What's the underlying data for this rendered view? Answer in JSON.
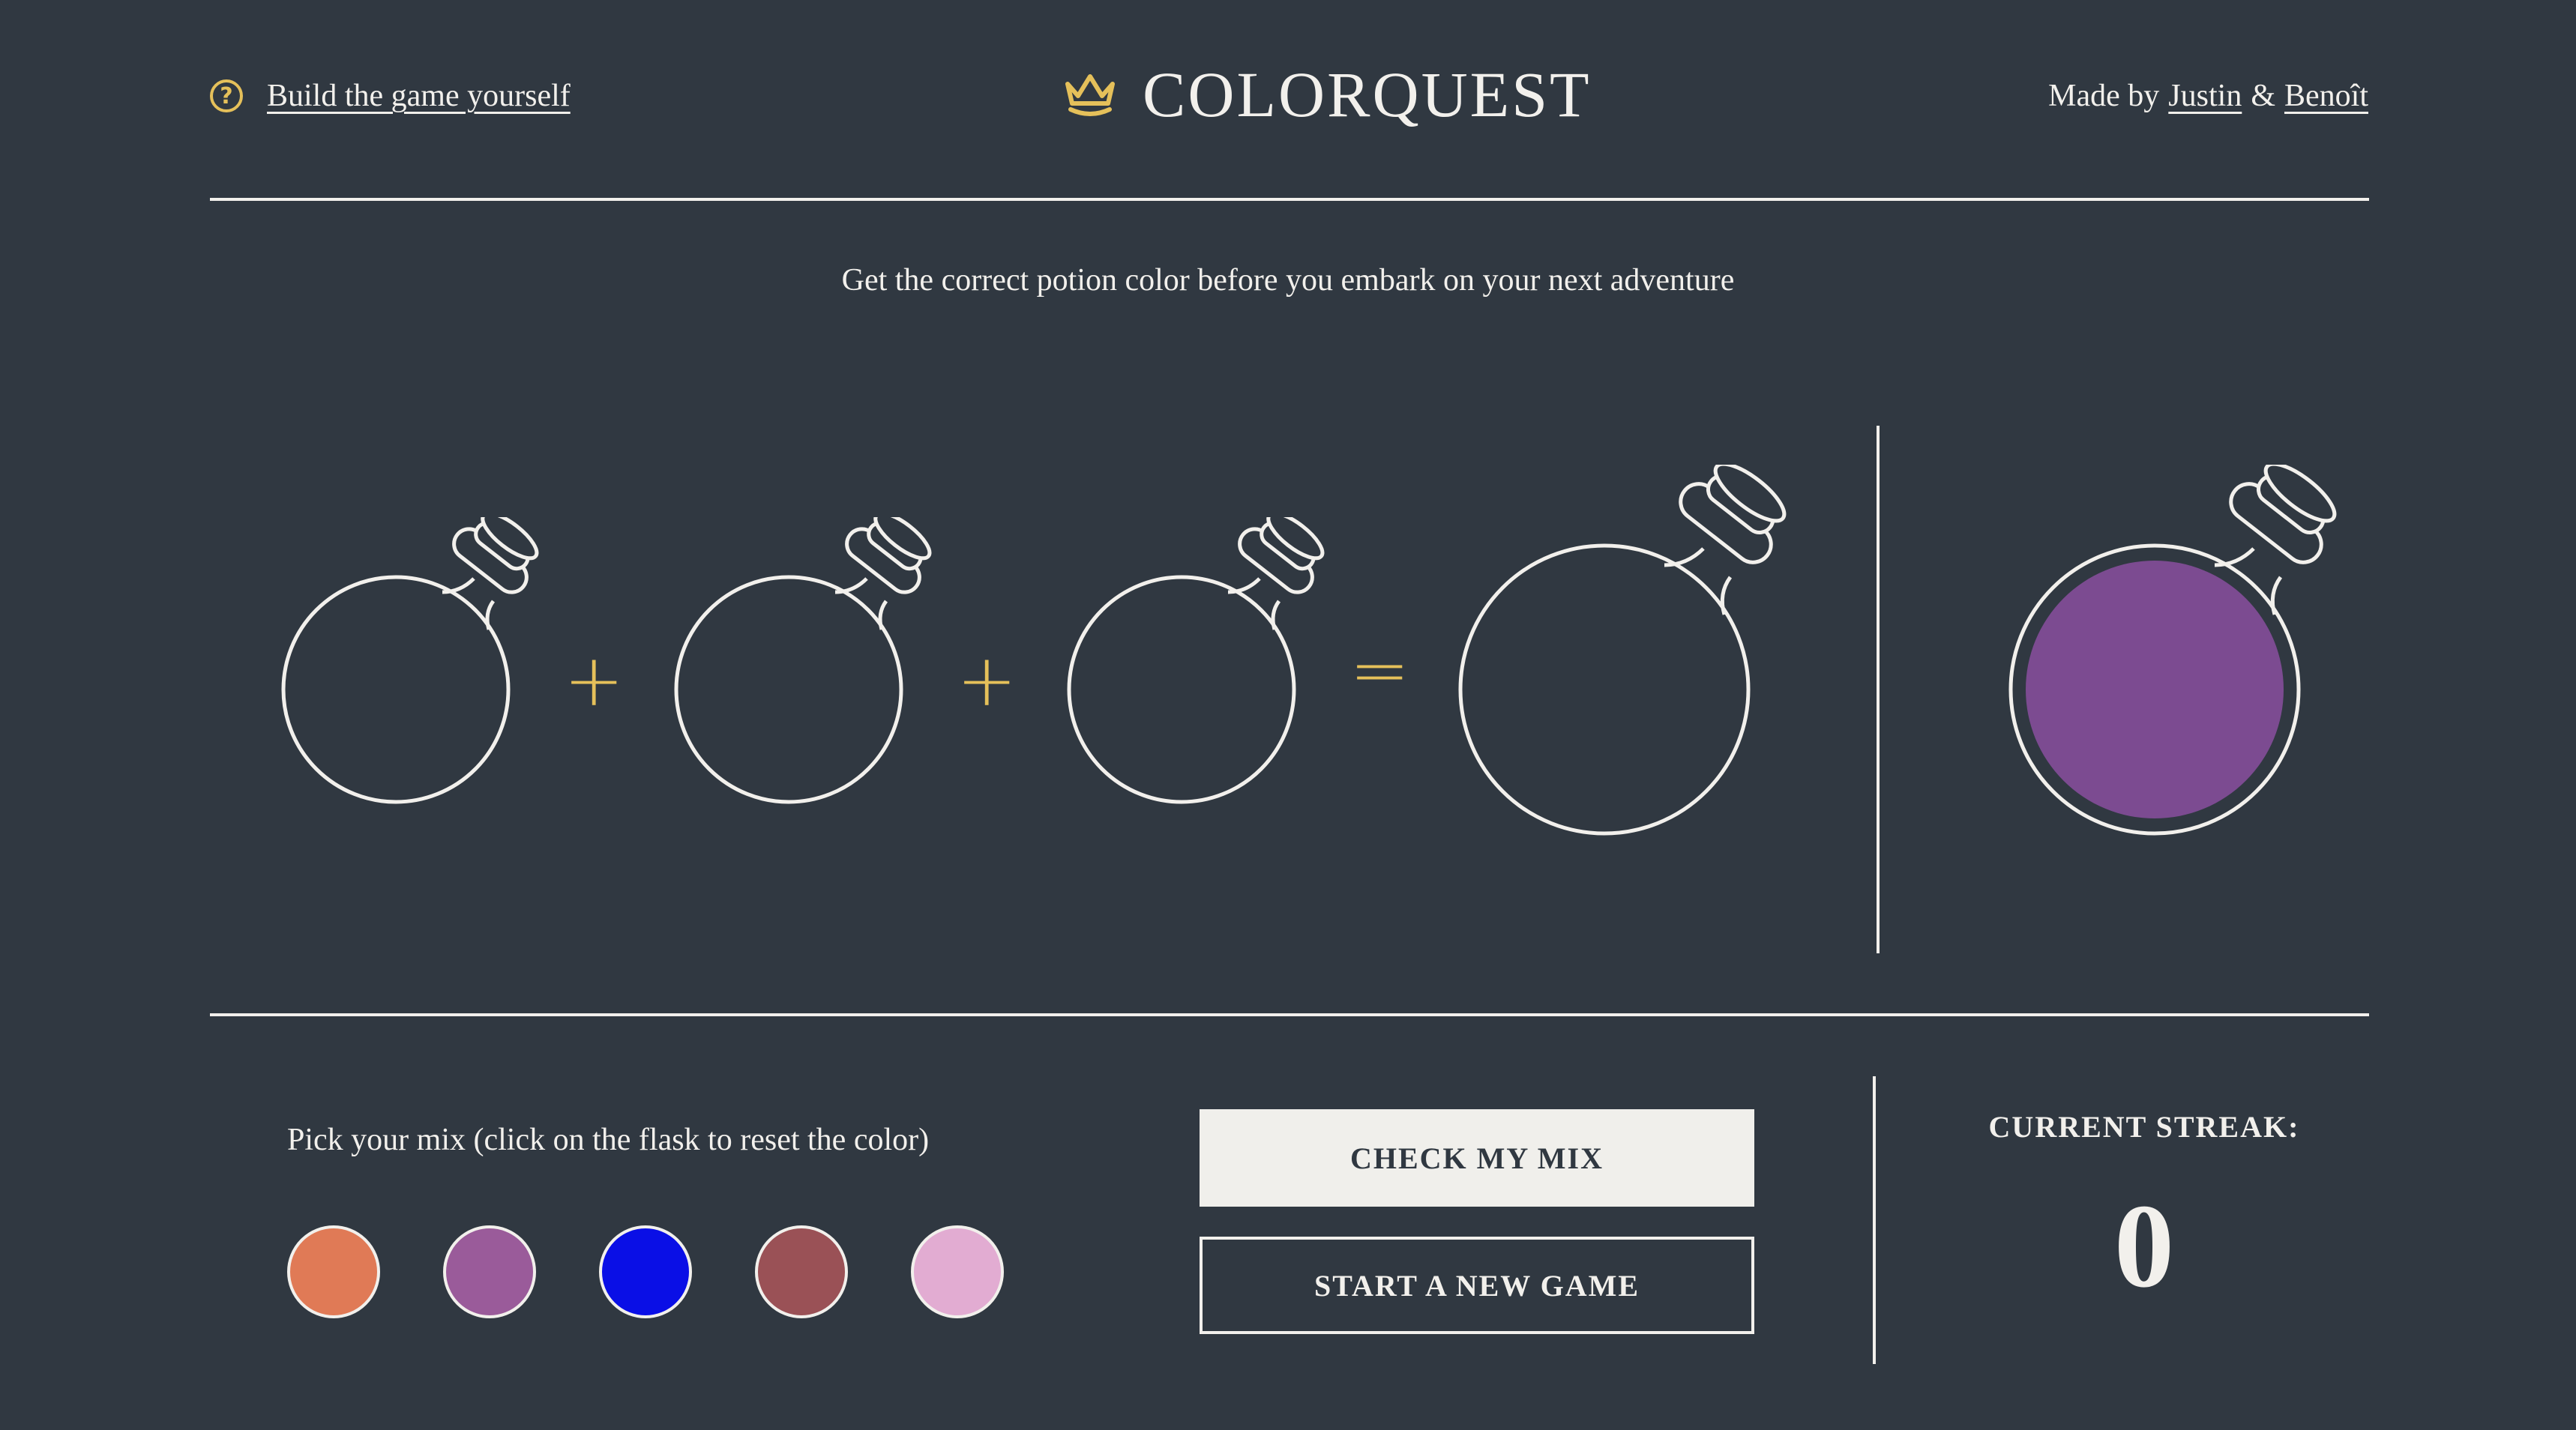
{
  "header": {
    "help_link": "Build the game yourself",
    "title": "COLORQUEST",
    "credits_prefix": "Made by",
    "author1": "Justin",
    "credits_sep": "&",
    "author2": "Benoît"
  },
  "subtitle": "Get the correct potion color before you embark on your next adventure",
  "mix": {
    "plus1": "+",
    "plus2": "+",
    "equals": "=",
    "slots": [
      "",
      "",
      ""
    ],
    "result": "",
    "target_color": "#7c4b91"
  },
  "picker": {
    "label": "Pick your mix (click on the flask to reset the color)",
    "colors": [
      "#e07a56",
      "#9a5b9a",
      "#0a0fe6",
      "#9a5156",
      "#e2acd2"
    ]
  },
  "buttons": {
    "check": "CHECK MY MIX",
    "new_game": "START A NEW GAME"
  },
  "streak": {
    "label": "CURRENT STREAK:",
    "value": "0"
  },
  "colors": {
    "background": "#303841",
    "accent": "#e5c05a",
    "line": "#f2f0ec"
  },
  "icons": {
    "help": "question-circle-icon",
    "brand": "crown-icon"
  }
}
